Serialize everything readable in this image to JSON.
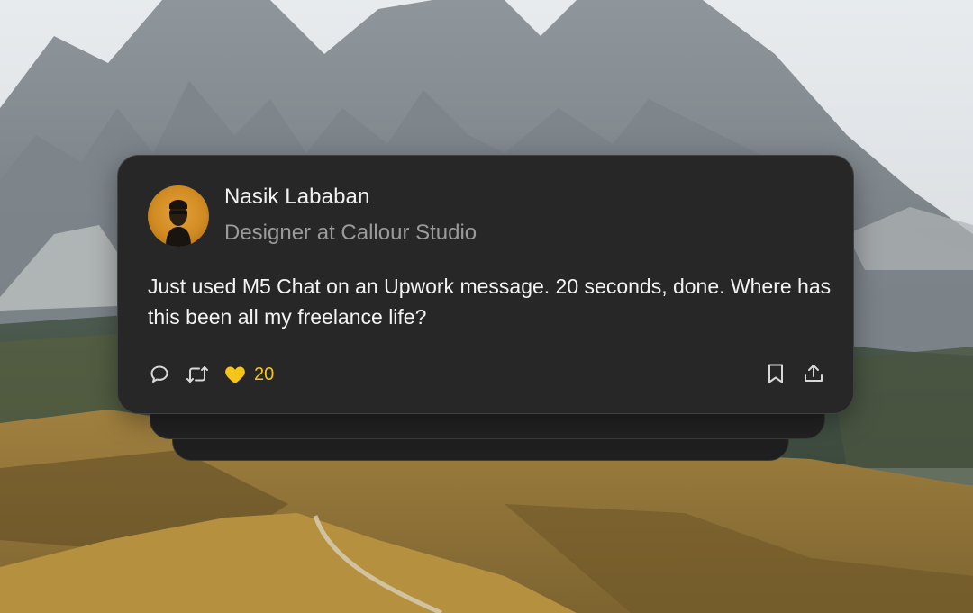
{
  "post": {
    "author_name": "Nasik Lababan",
    "author_title": "Designer at Callour Studio",
    "text": "Just used M5 Chat on an Upwork message. 20 seconds, done. Where has this been all my freelance life?",
    "like_count": "20"
  },
  "icons": {
    "reply": "comment-icon",
    "repost": "repost-icon",
    "like": "heart-icon",
    "bookmark": "bookmark-icon",
    "share": "share-icon"
  },
  "colors": {
    "card_bg": "#272727",
    "card_border": "#414141",
    "like_accent": "#f5c518",
    "text_primary": "#f3f3f3",
    "text_secondary": "#9a9a9a"
  }
}
